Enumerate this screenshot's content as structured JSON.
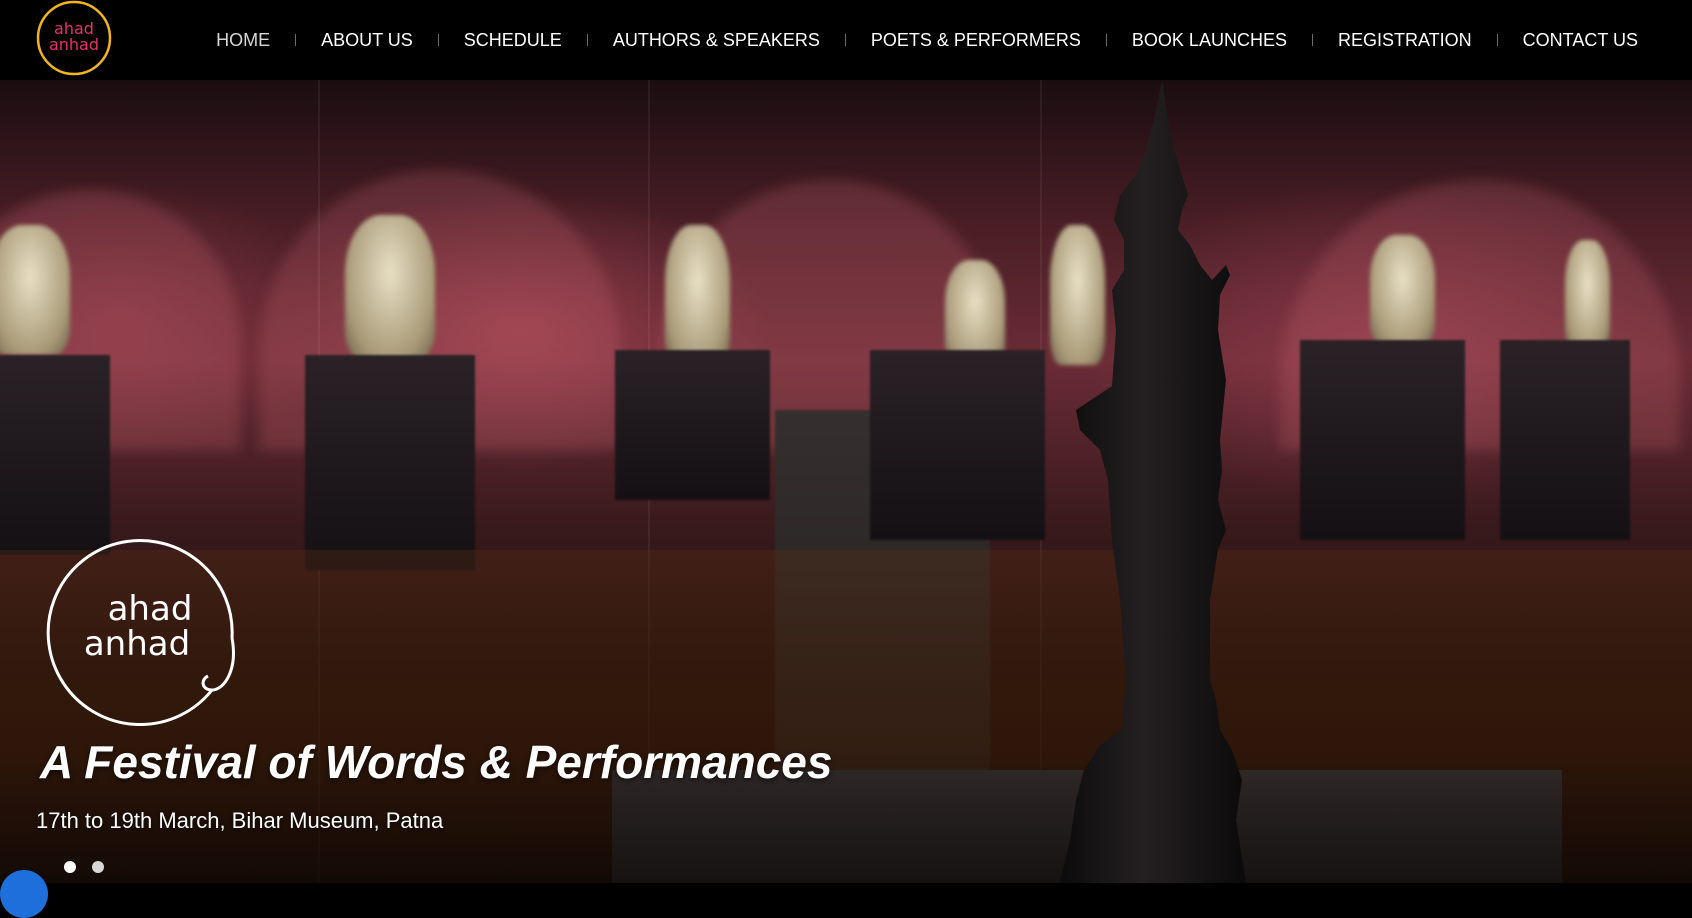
{
  "logo": {
    "line1": "ahad",
    "line2": "anhad",
    "small_line_color": "#e8306a",
    "ring_color": "#f2b51c"
  },
  "nav": {
    "items": [
      {
        "label": "HOME",
        "active": true
      },
      {
        "label": "ABOUT US",
        "active": false
      },
      {
        "label": "SCHEDULE",
        "active": false
      },
      {
        "label": "AUTHORS & SPEAKERS",
        "active": false
      },
      {
        "label": "POETS & PERFORMERS",
        "active": false
      },
      {
        "label": "BOOK LAUNCHES",
        "active": false
      },
      {
        "label": "REGISTRATION",
        "active": false
      },
      {
        "label": "CONTACT US",
        "active": false
      }
    ]
  },
  "hero": {
    "logo_line1": "ahad",
    "logo_line2": "anhad",
    "title": "A Festival of Words & Performances",
    "subtitle": "17th to 19th March, Bihar Museum, Patna",
    "slide_count": 2,
    "active_slide": 1
  },
  "colors": {
    "nav_bg": "#000000",
    "text": "#ffffff"
  }
}
